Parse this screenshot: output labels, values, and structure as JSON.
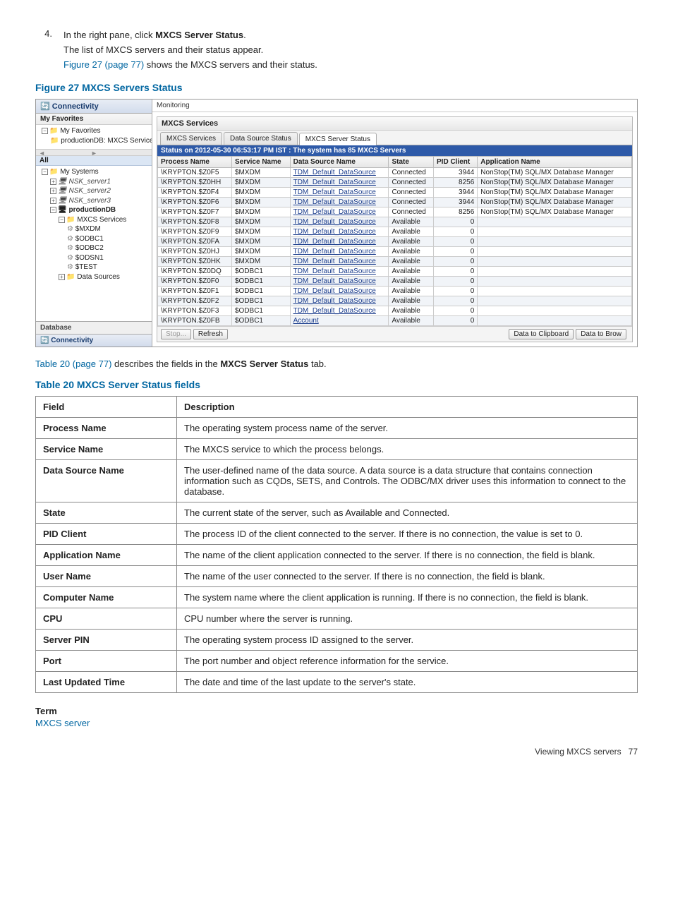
{
  "step": {
    "num": "4.",
    "line1_a": "In the right pane, click ",
    "line1_b": "MXCS Server Status",
    "line1_c": ".",
    "line2": "The list of MXCS servers and their status appear.",
    "line3_link": "Figure 27 (page 77)",
    "line3_rest": " shows the MXCS servers and their status."
  },
  "figure_caption": "Figure 27 MXCS Servers Status",
  "nav": {
    "connectivity": "Connectivity",
    "favorites_hdr": "My Favorites",
    "favorites_item": "My Favorites",
    "fav_child": "productionDB: MXCS Services",
    "all": "All",
    "systems": "My Systems",
    "srv1": "NSK_server1",
    "srv2": "NSK_server2",
    "srv3": "NSK_server3",
    "prod": "productionDB",
    "mxcs_services": "MXCS Services",
    "mxdm": "$MXDM",
    "odbc1": "$ODBC1",
    "odbc2": "$ODBC2",
    "odsn1": "$ODSN1",
    "stest": "$TEST",
    "data_sources": "Data Sources",
    "database_tab": "Database",
    "connectivity_tab": "Connectivity"
  },
  "main": {
    "crumb": "Monitoring",
    "panel_title": "MXCS Services",
    "tab1": "MXCS Services",
    "tab2": "Data Source Status",
    "tab3": "MXCS Server Status",
    "status": "Status on 2012-05-30 06:53:17 PM IST : The system has 85 MXCS Servers",
    "cols": {
      "c1": "Process Name",
      "c2": "Service Name",
      "c3": "Data Source Name",
      "c4": "State",
      "c5": "PID Client",
      "c6": "Application Name"
    },
    "rows": [
      {
        "p": "\\KRYPTON.$Z0F5",
        "s": "$MXDM",
        "d": "TDM_Default_DataSource",
        "st": "Connected",
        "pid": "3944",
        "app": "NonStop(TM) SQL/MX Database Manager"
      },
      {
        "p": "\\KRYPTON.$Z0HH",
        "s": "$MXDM",
        "d": "TDM_Default_DataSource",
        "st": "Connected",
        "pid": "8256",
        "app": "NonStop(TM) SQL/MX Database Manager"
      },
      {
        "p": "\\KRYPTON.$Z0F4",
        "s": "$MXDM",
        "d": "TDM_Default_DataSource",
        "st": "Connected",
        "pid": "3944",
        "app": "NonStop(TM) SQL/MX Database Manager"
      },
      {
        "p": "\\KRYPTON.$Z0F6",
        "s": "$MXDM",
        "d": "TDM_Default_DataSource",
        "st": "Connected",
        "pid": "3944",
        "app": "NonStop(TM) SQL/MX Database Manager"
      },
      {
        "p": "\\KRYPTON.$Z0F7",
        "s": "$MXDM",
        "d": "TDM_Default_DataSource",
        "st": "Connected",
        "pid": "8256",
        "app": "NonStop(TM) SQL/MX Database Manager"
      },
      {
        "p": "\\KRYPTON.$Z0F8",
        "s": "$MXDM",
        "d": "TDM_Default_DataSource",
        "st": "Available",
        "pid": "0",
        "app": ""
      },
      {
        "p": "\\KRYPTON.$Z0F9",
        "s": "$MXDM",
        "d": "TDM_Default_DataSource",
        "st": "Available",
        "pid": "0",
        "app": ""
      },
      {
        "p": "\\KRYPTON.$Z0FA",
        "s": "$MXDM",
        "d": "TDM_Default_DataSource",
        "st": "Available",
        "pid": "0",
        "app": ""
      },
      {
        "p": "\\KRYPTON.$Z0HJ",
        "s": "$MXDM",
        "d": "TDM_Default_DataSource",
        "st": "Available",
        "pid": "0",
        "app": ""
      },
      {
        "p": "\\KRYPTON.$Z0HK",
        "s": "$MXDM",
        "d": "TDM_Default_DataSource",
        "st": "Available",
        "pid": "0",
        "app": ""
      },
      {
        "p": "\\KRYPTON.$Z0DQ",
        "s": "$ODBC1",
        "d": "TDM_Default_DataSource",
        "st": "Available",
        "pid": "0",
        "app": ""
      },
      {
        "p": "\\KRYPTON.$Z0F0",
        "s": "$ODBC1",
        "d": "TDM_Default_DataSource",
        "st": "Available",
        "pid": "0",
        "app": ""
      },
      {
        "p": "\\KRYPTON.$Z0F1",
        "s": "$ODBC1",
        "d": "TDM_Default_DataSource",
        "st": "Available",
        "pid": "0",
        "app": ""
      },
      {
        "p": "\\KRYPTON.$Z0F2",
        "s": "$ODBC1",
        "d": "TDM_Default_DataSource",
        "st": "Available",
        "pid": "0",
        "app": ""
      },
      {
        "p": "\\KRYPTON.$Z0F3",
        "s": "$ODBC1",
        "d": "TDM_Default_DataSource",
        "st": "Available",
        "pid": "0",
        "app": ""
      },
      {
        "p": "\\KRYPTON.$Z0FB",
        "s": "$ODBC1",
        "d": "Account",
        "st": "Available",
        "pid": "0",
        "app": ""
      }
    ],
    "btn_stop": "Stop...",
    "btn_refresh": "Refresh",
    "btn_clip": "Data to Clipboard",
    "btn_brow": "Data to Brow"
  },
  "after_fig": {
    "link": "Table 20 (page 77)",
    "rest_a": " describes the fields in the ",
    "rest_b": "MXCS Server Status",
    "rest_c": " tab."
  },
  "table_caption": "Table 20 MXCS Server Status fields",
  "fields_header": {
    "f": "Field",
    "d": "Description"
  },
  "fields": [
    {
      "f": "Process Name",
      "d": "The operating system process name of the server."
    },
    {
      "f": "Service Name",
      "d": "The MXCS service to which the process belongs."
    },
    {
      "f": "Data Source Name",
      "d": "The user-defined name of the data source. A data source is a data structure that contains connection information such as CQDs, SETS, and Controls. The ODBC/MX driver uses this information to connect to the database."
    },
    {
      "f": "State",
      "d": "The current state of the server, such as Available and Connected."
    },
    {
      "f": "PID Client",
      "d": "The process ID of the client connected to the server. If there is no connection, the value is set to 0."
    },
    {
      "f": "Application Name",
      "d": "The name of the client application connected to the server. If there is no connection, the field is blank."
    },
    {
      "f": "User Name",
      "d": "The name of the user connected to the server. If there is no connection, the field is blank."
    },
    {
      "f": "Computer Name",
      "d": "The system name where the client application is running. If there is no connection, the field is blank."
    },
    {
      "f": "CPU",
      "d": "CPU number where the server is running."
    },
    {
      "f": "Server PIN",
      "d": "The operating system process ID assigned to the server."
    },
    {
      "f": "Port",
      "d": "The port number and object reference information for the service."
    },
    {
      "f": "Last Updated Time",
      "d": "The date and time of the last update to the server's state."
    }
  ],
  "term": {
    "label": "Term",
    "value": "MXCS server"
  },
  "footer": {
    "text": "Viewing MXCS servers",
    "page": "77"
  }
}
